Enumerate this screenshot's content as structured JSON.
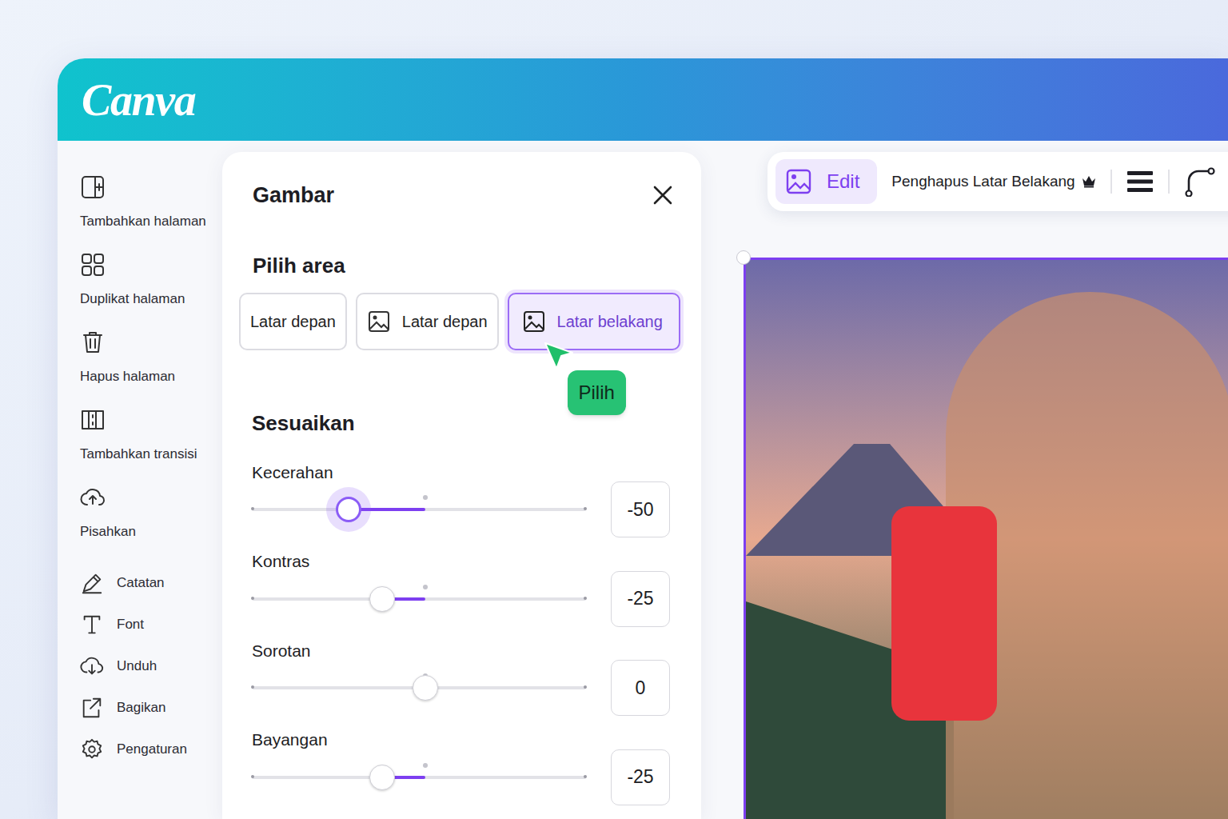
{
  "header": {
    "logo": "Canva"
  },
  "sidebar": {
    "items": [
      {
        "label": "Tambahkan halaman",
        "kind": "stacked"
      },
      {
        "label": "Duplikat halaman",
        "kind": "stacked"
      },
      {
        "label": "Hapus halaman",
        "kind": "stacked"
      },
      {
        "label": "Tambahkan transisi",
        "kind": "stacked"
      },
      {
        "label": "Pisahkan",
        "kind": "stacked"
      },
      {
        "label": "Catatan",
        "kind": "inline"
      },
      {
        "label": "Font",
        "kind": "inline"
      },
      {
        "label": "Unduh",
        "kind": "inline"
      },
      {
        "label": "Bagikan",
        "kind": "inline"
      },
      {
        "label": "Pengaturan",
        "kind": "inline"
      }
    ]
  },
  "panel": {
    "title": "Gambar",
    "area": {
      "heading": "Pilih area",
      "options": [
        {
          "label": "Latar depan",
          "kind": "text",
          "selected": false
        },
        {
          "label": "Latar depan",
          "kind": "icon",
          "selected": false
        },
        {
          "label": "Latar belakang",
          "kind": "icon",
          "selected": true
        }
      ]
    },
    "cursor_tooltip": "Pilih",
    "adjust": {
      "heading": "Sesuaikan",
      "sliders": [
        {
          "label": "Kecerahan",
          "level": 0.29,
          "reading": "-50",
          "active": true
        },
        {
          "label": "Kontras",
          "level": 0.39,
          "reading": "-25",
          "active": false
        },
        {
          "label": "Sorotan",
          "level": 0.52,
          "reading": "0",
          "active": false
        },
        {
          "label": "Bayangan",
          "level": 0.39,
          "reading": "-25",
          "active": false
        }
      ]
    }
  },
  "toolbar": {
    "items": [
      {
        "label": "Edit",
        "selected": true
      },
      {
        "label": "Penghapus Latar Belakang",
        "selected": false
      }
    ]
  }
}
